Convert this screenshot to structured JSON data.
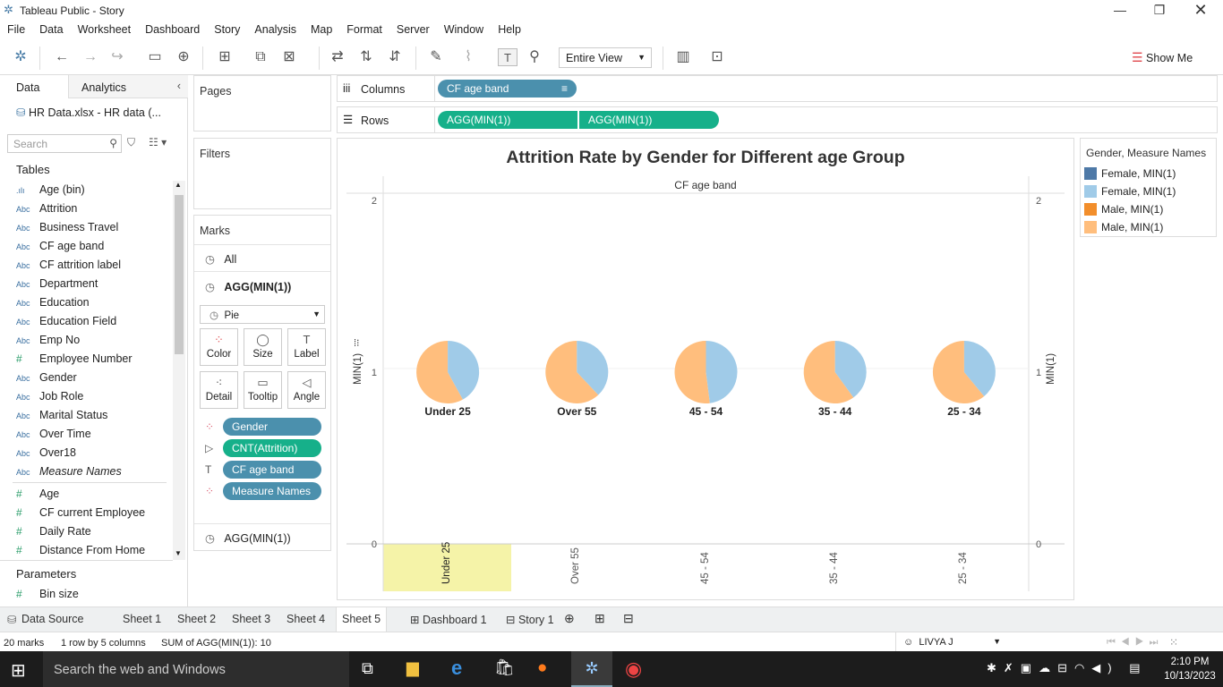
{
  "window": {
    "title": "Tableau Public - Story"
  },
  "menu": [
    "File",
    "Data",
    "Worksheet",
    "Dashboard",
    "Story",
    "Analysis",
    "Map",
    "Format",
    "Server",
    "Window",
    "Help"
  ],
  "toolbar": {
    "fit": "Entire View",
    "show_me": "Show Me"
  },
  "left": {
    "tab_data": "Data",
    "tab_analytics": "Analytics",
    "datasource": "HR Data.xlsx - HR data (...",
    "search_placeholder": "Search",
    "tables_header": "Tables",
    "dimensions": [
      {
        "icon": "bin",
        "name": "Age (bin)"
      },
      {
        "icon": "Abc",
        "name": "Attrition"
      },
      {
        "icon": "Abc",
        "name": "Business Travel"
      },
      {
        "icon": "Abc",
        "name": "CF age band"
      },
      {
        "icon": "Abc",
        "name": "CF attrition label"
      },
      {
        "icon": "Abc",
        "name": "Department"
      },
      {
        "icon": "Abc",
        "name": "Education"
      },
      {
        "icon": "Abc",
        "name": "Education Field"
      },
      {
        "icon": "Abc",
        "name": "Emp No"
      },
      {
        "icon": "#",
        "name": "Employee Number"
      },
      {
        "icon": "Abc",
        "name": "Gender"
      },
      {
        "icon": "Abc",
        "name": "Job Role"
      },
      {
        "icon": "Abc",
        "name": "Marital Status"
      },
      {
        "icon": "Abc",
        "name": "Over Time"
      },
      {
        "icon": "Abc",
        "name": "Over18"
      },
      {
        "icon": "Abc",
        "name": "Measure Names"
      }
    ],
    "measures": [
      {
        "icon": "#",
        "name": "Age"
      },
      {
        "icon": "#",
        "name": "CF current Employee"
      },
      {
        "icon": "#",
        "name": "Daily Rate"
      },
      {
        "icon": "#",
        "name": "Distance From Home"
      }
    ],
    "parameters_header": "Parameters",
    "parameters": [
      {
        "icon": "#",
        "name": "Bin size"
      }
    ]
  },
  "cards": {
    "pages": "Pages",
    "filters": "Filters",
    "marks": "Marks",
    "marks_all": "All",
    "marks_agg": "AGG(MIN(1))",
    "mark_type": "Pie",
    "buttons": [
      "Color",
      "Size",
      "Label",
      "Detail",
      "Tooltip",
      "Angle"
    ],
    "mark_pills": [
      {
        "label": "Gender",
        "kind": "blue",
        "icon": "color"
      },
      {
        "label": "CNT(Attrition)",
        "kind": "green",
        "icon": "angle"
      },
      {
        "label": "CF age band",
        "kind": "blue",
        "icon": "label"
      },
      {
        "label": "Measure Names",
        "kind": "blue",
        "icon": "color"
      }
    ],
    "marks_agg2": "AGG(MIN(1))"
  },
  "shelves": {
    "columns_label": "Columns",
    "columns_pill": "CF age band",
    "rows_label": "Rows",
    "rows_pills": [
      "AGG(MIN(1))",
      "AGG(MIN(1))"
    ]
  },
  "chart_data": {
    "type": "pie",
    "title": "Attrition Rate by Gender for Different age Group",
    "column_header": "CF age band",
    "ylabel": "MIN(1)",
    "ylim": [
      0,
      2
    ],
    "y_ticks": [
      "2",
      "1",
      "0"
    ],
    "categories": [
      "Under 25",
      "Over 55",
      "45 - 54",
      "35 - 44",
      "25 - 34"
    ],
    "slices": [
      {
        "category": "Under 25",
        "Male": 0.58,
        "Female": 0.42
      },
      {
        "category": "Over 55",
        "Male": 0.62,
        "Female": 0.38
      },
      {
        "category": "45 - 54",
        "Male": 0.52,
        "Female": 0.48
      },
      {
        "category": "35 - 44",
        "Male": 0.6,
        "Female": 0.4
      },
      {
        "category": "25 - 34",
        "Male": 0.61,
        "Female": 0.39
      }
    ],
    "highlighted_category": "Under 25",
    "colors": {
      "male": "#ffbe7d",
      "female": "#a0cbe8",
      "highlight": "#f5f3a8"
    }
  },
  "legend": {
    "title": "Gender, Measure Names",
    "items": [
      {
        "label": "Female, MIN(1)",
        "color": "#4e79a7"
      },
      {
        "label": "Female, MIN(1)",
        "color": "#a0cbe8"
      },
      {
        "label": "Male, MIN(1)",
        "color": "#f28e2b"
      },
      {
        "label": "Male, MIN(1)",
        "color": "#ffbe7d"
      }
    ]
  },
  "tabs": [
    "Data Source",
    "Sheet 1",
    "Sheet 2",
    "Sheet 3",
    "Sheet 4",
    "Sheet 5",
    "Dashboard 1",
    "Story 1"
  ],
  "active_tab": "Sheet 5",
  "status": {
    "marks": "20 marks",
    "dims": "1 row by 5 columns",
    "sum": "SUM of AGG(MIN(1)): 10",
    "user": "LIVYA J"
  },
  "taskbar": {
    "search": "Search the web and Windows",
    "time": "2:10 PM",
    "date": "10/13/2023"
  }
}
